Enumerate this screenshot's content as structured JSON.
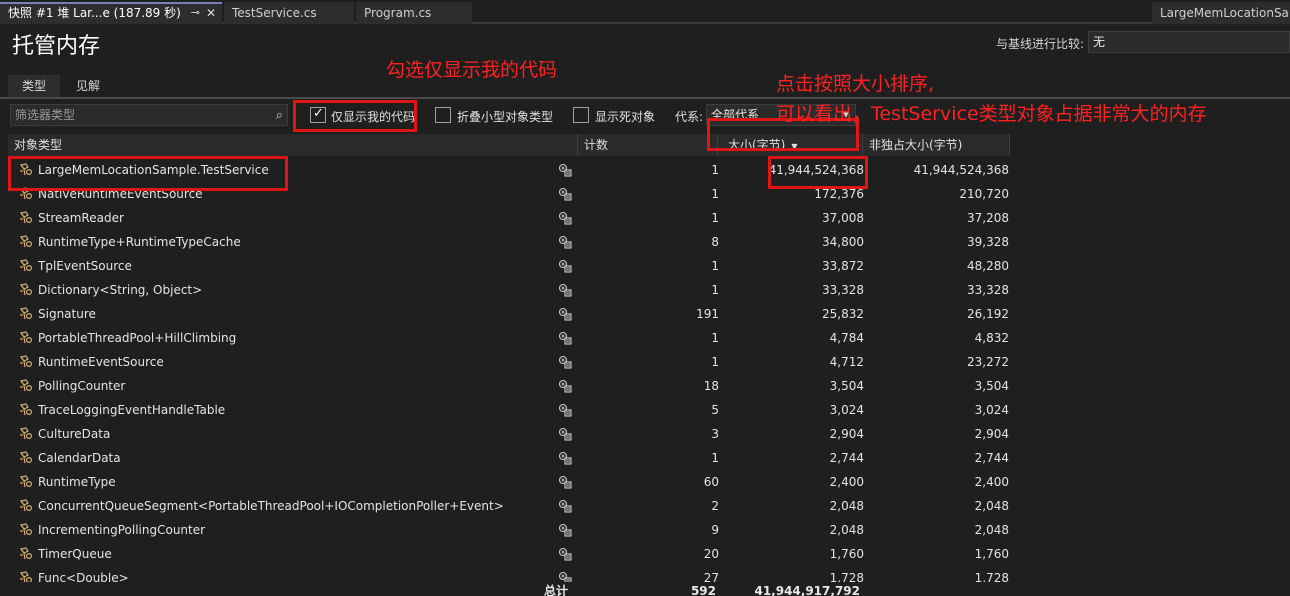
{
  "tabs": [
    {
      "label": "快照 #1 堆 Lar...e (187.89 秒)",
      "active": true,
      "pin": "⊸",
      "close": "✕"
    },
    {
      "label": "TestService.cs",
      "active": false
    },
    {
      "label": "Program.cs",
      "active": false
    },
    {
      "label": "LargeMemLocationSar",
      "active": false
    }
  ],
  "header": {
    "title": "托管内存",
    "baseline_label": "与基线进行比较:",
    "baseline_value": "无"
  },
  "subtabs": [
    "类型",
    "见解"
  ],
  "toolbar": {
    "filter_placeholder": "筛选器类型",
    "search_icon": "⌕",
    "just_my_code": {
      "label": "仅显示我的代码",
      "checked": true
    },
    "collapse_small": {
      "label": "折叠小型对象类型",
      "checked": false
    },
    "show_dead": {
      "label": "显示死对象",
      "checked": false
    },
    "generation_label": "代系:",
    "generation_value": "全部代系"
  },
  "columns": {
    "type": "对象类型",
    "count": "计数",
    "size": "大小(字节)",
    "inclusive": "非独占大小(字节)"
  },
  "rows": [
    {
      "name": "LargeMemLocationSample.TestService",
      "count": "1",
      "size": "41,944,524,368",
      "inclusive": "41,944,524,368"
    },
    {
      "name": "NativeRuntimeEventSource",
      "count": "1",
      "size": "172,376",
      "inclusive": "210,720"
    },
    {
      "name": "StreamReader",
      "count": "1",
      "size": "37,008",
      "inclusive": "37,208"
    },
    {
      "name": "RuntimeType+RuntimeTypeCache",
      "count": "8",
      "size": "34,800",
      "inclusive": "39,328"
    },
    {
      "name": "TplEventSource",
      "count": "1",
      "size": "33,872",
      "inclusive": "48,280"
    },
    {
      "name": "Dictionary<String, Object>",
      "count": "1",
      "size": "33,328",
      "inclusive": "33,328"
    },
    {
      "name": "Signature",
      "count": "191",
      "size": "25,832",
      "inclusive": "26,192"
    },
    {
      "name": "PortableThreadPool+HillClimbing",
      "count": "1",
      "size": "4,784",
      "inclusive": "4,832"
    },
    {
      "name": "RuntimeEventSource",
      "count": "1",
      "size": "4,712",
      "inclusive": "23,272"
    },
    {
      "name": "PollingCounter",
      "count": "18",
      "size": "3,504",
      "inclusive": "3,504"
    },
    {
      "name": "TraceLoggingEventHandleTable",
      "count": "5",
      "size": "3,024",
      "inclusive": "3,024"
    },
    {
      "name": "CultureData",
      "count": "3",
      "size": "2,904",
      "inclusive": "2,904"
    },
    {
      "name": "CalendarData",
      "count": "1",
      "size": "2,744",
      "inclusive": "2,744"
    },
    {
      "name": "RuntimeType",
      "count": "60",
      "size": "2,400",
      "inclusive": "2,400"
    },
    {
      "name": "ConcurrentQueueSegment<PortableThreadPool+IOCompletionPoller+Event>",
      "count": "2",
      "size": "2,048",
      "inclusive": "2,048"
    },
    {
      "name": "IncrementingPollingCounter",
      "count": "9",
      "size": "2,048",
      "inclusive": "2,048"
    },
    {
      "name": "TimerQueue",
      "count": "20",
      "size": "1,760",
      "inclusive": "1,760"
    },
    {
      "name": "Func<Double>",
      "count": "27",
      "size": "1,728",
      "inclusive": "1,728"
    }
  ],
  "totals": {
    "label": "总计",
    "count": "592",
    "size": "41,944,917,792"
  },
  "annotations": {
    "just_my_code_note": "勾选仅显示我的代码",
    "sort_note_line1": "点击按照大小排序,",
    "sort_note_line2": "可以看出，TestService类型对象占据非常大的内存"
  },
  "colors": {
    "annotation": "#ff2020",
    "background": "#1f1f1f"
  }
}
